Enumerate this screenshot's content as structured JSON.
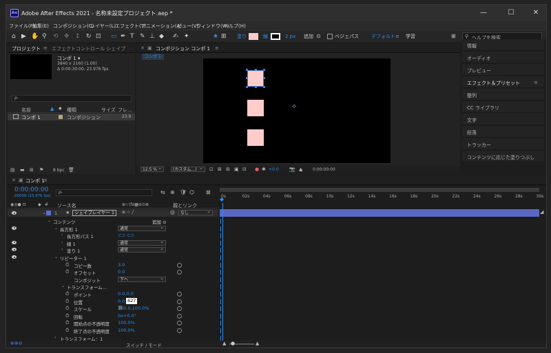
{
  "title_bar": {
    "app_icon": "Ae",
    "title": "Adobe After Effects 2021 - 名称未設定プロジェクト.aep *",
    "minimize": "—",
    "maximize": "☐",
    "close": "✕"
  },
  "menu": [
    "ファイル(F)",
    "編集(E)",
    "コンポジション(C)",
    "レイヤー(L)",
    "エフェクト(T)",
    "アニメーション(A)",
    "ビュー(V)",
    "ウィンドウ(W)",
    "ヘルプ(H)"
  ],
  "toolbar": {
    "fill_label": "塗り",
    "stroke_label": "線",
    "stroke_width": "2 px",
    "add_label": "追加",
    "bezier_label": "ベジェパス",
    "workspace_default": "デフォルト",
    "workspace_learn": "学習",
    "search_help_placeholder": "ヘルプを検索",
    "colors": {
      "fill": "#ffcccc",
      "stroke": "#ffffff",
      "accent": "#2d8ceb"
    }
  },
  "project_panel": {
    "tab": "プロジェクト",
    "effects_tab": "エフェクトコントロール シェイプ",
    "comp_name": "コンポ 1 ▾",
    "resolution": "3840 x 2160 (1.00)",
    "duration": "Δ 0:00:30:00, 23.976 fps",
    "search_placeholder": "ρ‐",
    "col_name": "名前",
    "col_type": "種類",
    "col_size": "サイズ",
    "col_frame": "フレ…",
    "item_name": "コンポ 1",
    "item_type": "コンポジション",
    "item_frame": "23.9",
    "bpc": "8 bpc"
  },
  "comp_panel": {
    "tab": "コンポジション コンポ 1",
    "sub_tab": "コンポ 1",
    "zoom": "12.5 %",
    "camera": "(カスタム…)",
    "exposure": "+0.0",
    "timecode": "0:00:00:00"
  },
  "right_panel": {
    "items": [
      "情報",
      "オーディオ",
      "プレビュー",
      "エフェクト＆プリセット",
      "整列",
      "CC ライブラリ",
      "文字",
      "段落",
      "トラッカー",
      "コンテンツに応じた塗りつぶし"
    ]
  },
  "timeline": {
    "tab": "コンポ 1",
    "timecode": "0:00:00:00",
    "timecode_sub": "00000 (23.976 fps)",
    "search_placeholder": "ρ‐",
    "col_source": "ソース名",
    "col_parent": "親とリンク",
    "layer_num": "1",
    "layer_name": "シェイプレイヤー 1",
    "parent_value": "なし",
    "rows": [
      {
        "indent": 1,
        "label": "コンテンツ",
        "extra": "追加 ⊙"
      },
      {
        "indent": 2,
        "label": "長方形 1",
        "mode": "通常"
      },
      {
        "indent": 3,
        "label": "長方形パス 1",
        "extra": "⊂⊃ ⊂⊃"
      },
      {
        "indent": 3,
        "label": "線 1",
        "mode": "通常"
      },
      {
        "indent": 3,
        "label": "塗り 1",
        "mode": "通常"
      },
      {
        "indent": 2,
        "label": "リピーター 1"
      },
      {
        "indent": 4,
        "label": "コピー数",
        "value": "3.0"
      },
      {
        "indent": 4,
        "label": "オフセット",
        "value": "0.0"
      },
      {
        "indent": 4,
        "label": "コンポジット",
        "mode": "下へ"
      },
      {
        "indent": 3,
        "label": "トランスフォーム…"
      },
      {
        "indent": 4,
        "label": "ポイント",
        "value": "0.0,0.0"
      },
      {
        "indent": 4,
        "label": "位置",
        "value": "0.0",
        "value2": "627"
      },
      {
        "indent": 4,
        "label": "スケール",
        "value": "100.0,100.0%"
      },
      {
        "indent": 4,
        "label": "回転",
        "value": "0x+0.0°"
      },
      {
        "indent": 4,
        "label": "開始点の不透明度",
        "value": "100.0%"
      },
      {
        "indent": 4,
        "label": "終了点の不透明度",
        "value": "100.0%"
      },
      {
        "indent": 2,
        "label": "トランスフォーム：1"
      }
    ],
    "ruler": [
      "0s",
      "02s",
      "04s",
      "06s",
      "08s",
      "10s",
      "12s",
      "14s",
      "16s",
      "18s",
      "20s",
      "22s",
      "24s",
      "26s",
      "28s",
      "30s"
    ],
    "switch_mode": "スイッチ / モード"
  }
}
